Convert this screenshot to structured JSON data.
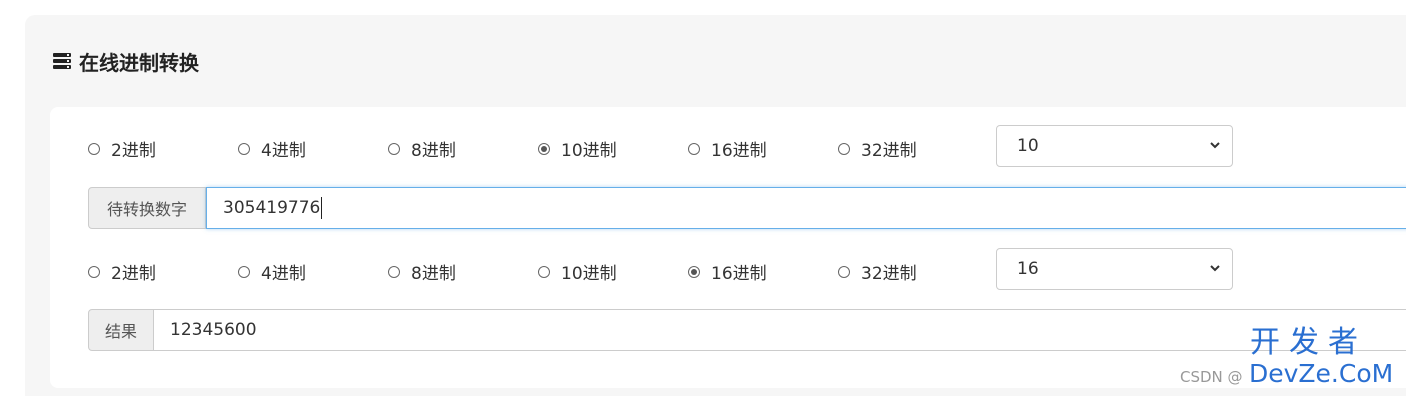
{
  "title": "在线进制转换",
  "input_row": {
    "options": [
      "2进制",
      "4进制",
      "8进制",
      "10进制",
      "16进制",
      "32进制"
    ],
    "selected": "10进制",
    "select_value": "10"
  },
  "input_field": {
    "label": "待转换数字",
    "value": "305419776"
  },
  "output_row": {
    "options": [
      "2进制",
      "4进制",
      "8进制",
      "10进制",
      "16进制",
      "32进制"
    ],
    "selected": "16进制",
    "select_value": "16"
  },
  "result_field": {
    "label": "结果",
    "value": "12345600"
  },
  "watermark": {
    "csdn": "CSDN @",
    "brand_cn": "开发者",
    "brand_en": "DevZe.CoM"
  },
  "colors": {
    "focus_border": "#66afe9",
    "watermark": "#2a6fd1"
  }
}
